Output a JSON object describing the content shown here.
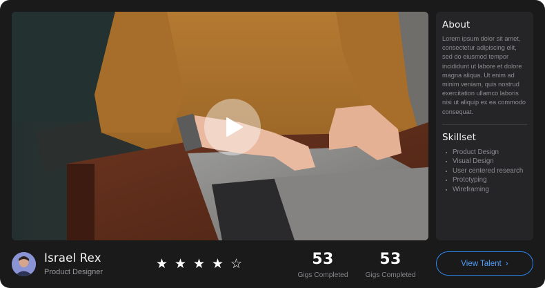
{
  "about": {
    "title": "About",
    "text": "Lorem ipsum dolor sit amet, consectetur adipiscing elit, sed do eiusmod tempor incididunt ut labore et dolore magna aliqua. Ut enim ad minim veniam, quis nostrud exercitation ullamco laboris nisi ut aliquip ex ea commodo consequat."
  },
  "skillset": {
    "title": "Skillset",
    "items": [
      {
        "label": "Product Design"
      },
      {
        "label": "Visual Design"
      },
      {
        "label": "User centered research"
      },
      {
        "label": "Prototyping"
      },
      {
        "label": "Wireframing"
      }
    ]
  },
  "profile": {
    "name": "Israel Rex",
    "role": "Product Designer"
  },
  "rating": {
    "value": 4,
    "max": 5,
    "stars": [
      "★",
      "★",
      "★",
      "★",
      "☆"
    ]
  },
  "stats": [
    {
      "value": "53",
      "label": "Gigs Completed"
    },
    {
      "value": "53",
      "label": "Gigs Completed"
    }
  ],
  "cta": {
    "label": "View Talent",
    "chevron": "›"
  },
  "icons": {
    "play": "play-icon",
    "chevron": "chevron-right-icon"
  },
  "colors": {
    "card": "#1a1a1b",
    "panel": "#252527",
    "accent": "#2e86f0"
  }
}
